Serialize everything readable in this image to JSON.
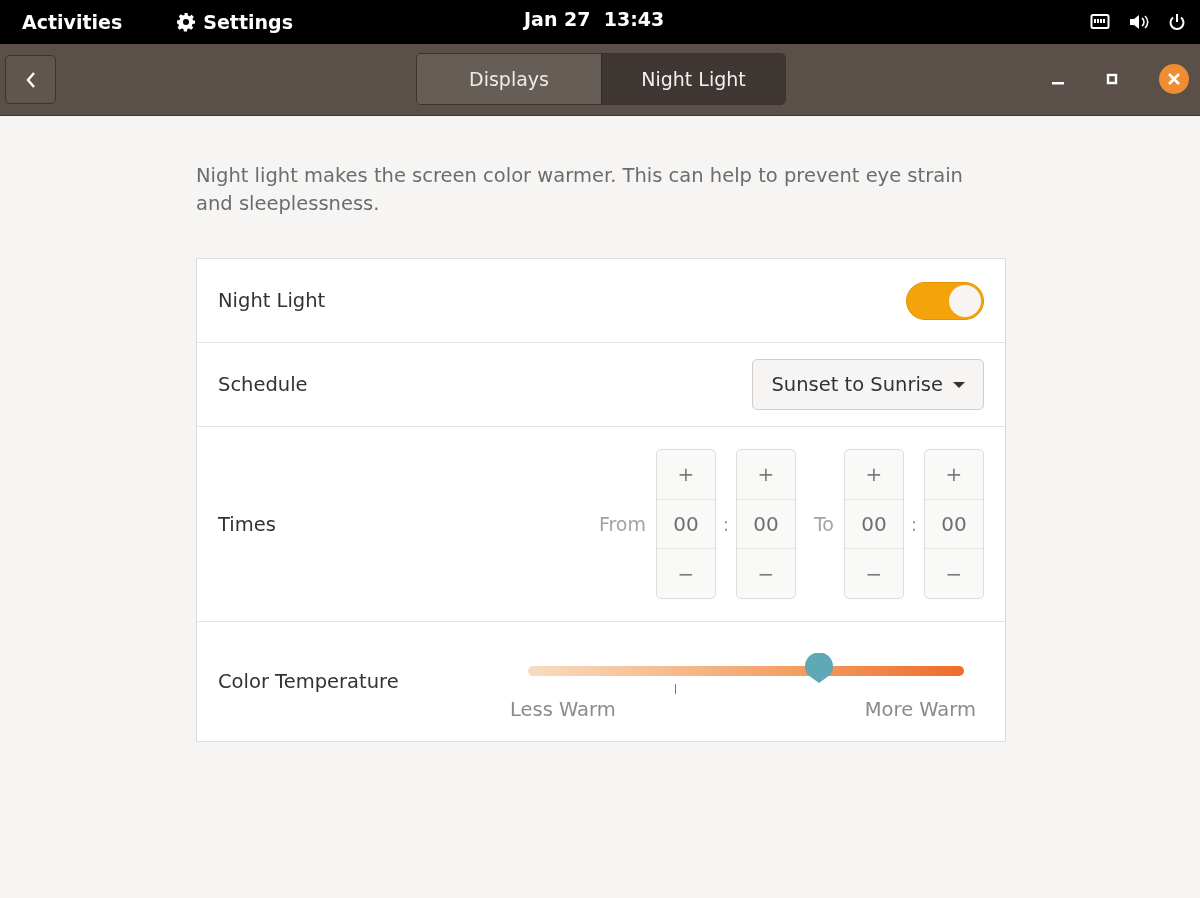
{
  "top_bar": {
    "activities": "Activities",
    "app_menu": "Settings",
    "clock": "Jan 27  13:43"
  },
  "header_bar": {
    "tabs": [
      {
        "label": "Displays",
        "selected": false
      },
      {
        "label": "Night Light",
        "selected": true
      }
    ]
  },
  "description": "Night light makes the screen color warmer. This can help to prevent eye strain and sleeplessness.",
  "night_light": {
    "label": "Night Light",
    "on": true
  },
  "schedule": {
    "label": "Schedule",
    "value": "Sunset to Sunrise"
  },
  "times": {
    "label": "Times",
    "from_label": "From",
    "to_label": "To",
    "separators": [
      ":",
      ":"
    ],
    "spinners": [
      {
        "plus": "+",
        "value": "00",
        "minus": "−"
      },
      {
        "plus": "+",
        "value": "00",
        "minus": "−"
      },
      {
        "plus": "+",
        "value": "00",
        "minus": "−"
      },
      {
        "plus": "+",
        "value": "00",
        "minus": "−"
      }
    ]
  },
  "color_temperature": {
    "label": "Color Temperature",
    "level": 0.667,
    "min_label": "Less Warm",
    "max_label": "More Warm"
  }
}
